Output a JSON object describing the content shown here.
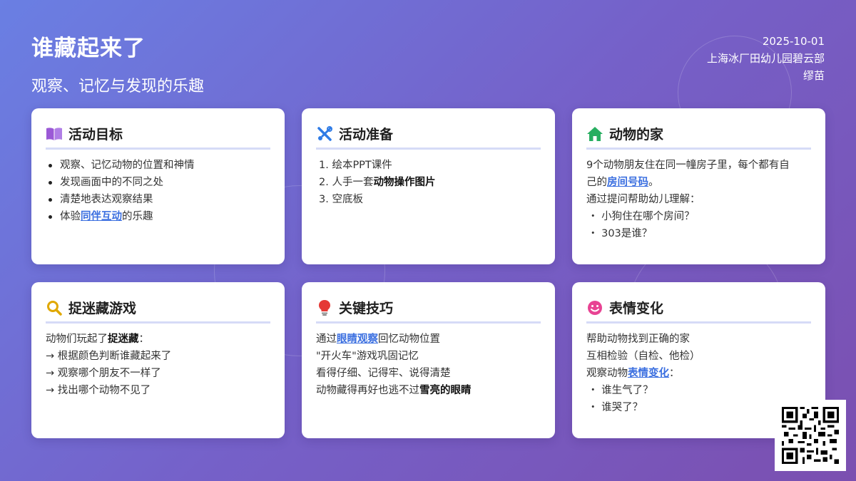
{
  "header": {
    "title": "谁藏起来了",
    "subtitle": "观察、记忆与发现的乐趣",
    "date": "2025-10-01",
    "school": "上海冰厂田幼儿园碧云部",
    "author": "缪苗"
  },
  "cards": {
    "goals": {
      "title": "活动目标",
      "icon": "book-icon",
      "items": [
        "观察、记忆动物的位置和神情",
        "发现画面中的不同之处",
        "清楚地表达观察结果"
      ],
      "item4_pre": "体验",
      "item4_hl": "同伴互动",
      "item4_post": "的乐趣"
    },
    "prep": {
      "title": "活动准备",
      "icon": "tools-icon",
      "item1": "1. 绘本PPT课件",
      "item2_pre": "2. 人手一套",
      "item2_bold": "动物操作图片",
      "item3": "3. 空底板"
    },
    "home": {
      "title": "动物的家",
      "icon": "house-icon",
      "line1": "9个动物朋友住在同一幢房子里，每个都有自",
      "line2_pre": "己的",
      "line2_hl": "房间号码",
      "line2_post": "。",
      "line3": "通过提问帮助幼儿理解：",
      "q1": "・ 小狗住在哪个房间？",
      "q2": "・ 303是谁？"
    },
    "hide": {
      "title": "捉迷藏游戏",
      "icon": "search-icon",
      "line1_pre": "动物们玩起了",
      "line1_bold": "捉迷藏",
      "line1_post": "：",
      "line2": "→ 根据颜色判断谁藏起来了",
      "line3": "→ 观察哪个朋友不一样了",
      "line4": "→ 找出哪个动物不见了"
    },
    "tips": {
      "title": "关键技巧",
      "icon": "lightbulb-icon",
      "line1_pre": "通过",
      "line1_hl": "眼睛观察",
      "line1_post": "回忆动物位置",
      "line2": "\"开火车\"游戏巩固记忆",
      "line3": "看得仔细、记得牢、说得清楚",
      "line4_pre": "动物藏得再好也逃不过",
      "line4_bold": "雪亮的眼睛"
    },
    "emotion": {
      "title": "表情变化",
      "icon": "smiley-icon",
      "line1": "帮助动物找到正确的家",
      "line2": "互相检验（自检、他检）",
      "line3_pre": "观察动物",
      "line3_hl": "表情变化",
      "line3_post": "：",
      "q1": "・ 谁生气了？",
      "q2": "・ 谁哭了？"
    }
  },
  "colors": {
    "accent": "#3b6fe0",
    "book": "#9b59d6",
    "tools": "#2e7be6",
    "house": "#27ae60",
    "search": "#e0a800",
    "bulb": "#e53935",
    "smiley": "#e84393"
  }
}
